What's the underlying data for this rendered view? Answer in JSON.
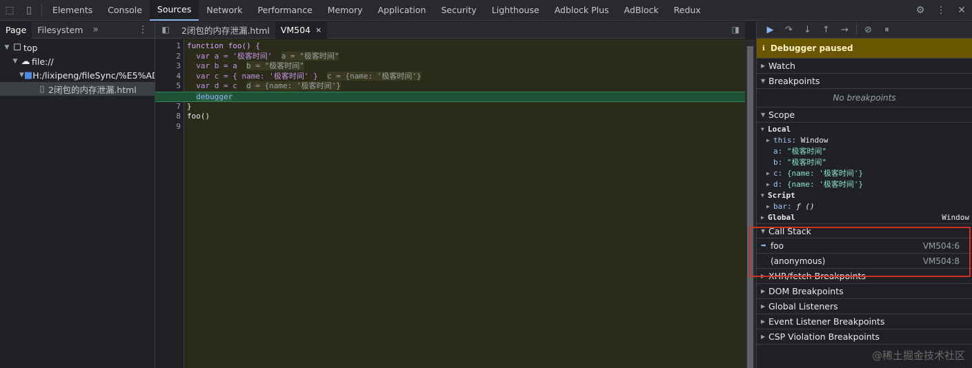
{
  "topbar": {
    "tabs": [
      "Elements",
      "Console",
      "Sources",
      "Network",
      "Performance",
      "Memory",
      "Application",
      "Security",
      "Lighthouse",
      "Adblock Plus",
      "AdBlock",
      "Redux"
    ],
    "active_tab": "Sources"
  },
  "navigator": {
    "tabs": [
      "Page",
      "Filesystem"
    ],
    "more": "»",
    "tree": [
      {
        "label": "top",
        "depth": 0,
        "icon": "frame-icon"
      },
      {
        "label": "file://",
        "depth": 1,
        "icon": "cloud-icon"
      },
      {
        "label": "H:/lixipeng/fileSync/%E5%AD%",
        "depth": 2,
        "icon": "folder-icon"
      },
      {
        "label": "2闭包的内存泄漏.html",
        "depth": 3,
        "icon": "file-icon"
      }
    ]
  },
  "editor": {
    "tabs": [
      {
        "label": "2闭包的内存泄漏.html",
        "active": false
      },
      {
        "label": "VM504",
        "active": true
      }
    ],
    "close_glyph": "×",
    "line_numbers": [
      "1",
      "2",
      "3",
      "4",
      "5",
      "6",
      "7",
      "8",
      "9"
    ],
    "code": {
      "l1": "function foo() {",
      "l2_a": "var a = '极客时间'",
      "l2_inl": "a = \"极客时间\"",
      "l3_a": "var b = a",
      "l3_inl": "b = \"极客时间\"",
      "l4_a": "var c = { name: '极客时间' }",
      "l4_inl": "c = {name: '极客时间'}",
      "l5_a": "var d = c",
      "l5_inl": "d = {name: '极客时间'}",
      "l6": "debugger",
      "l7": "}",
      "l8": "foo()"
    }
  },
  "debugger": {
    "paused_text": "Debugger paused",
    "sections": {
      "watch": "Watch",
      "breakpoints": "Breakpoints",
      "no_breakpoints": "No breakpoints",
      "scope": "Scope",
      "call_stack": "Call Stack",
      "xhr": "XHR/fetch Breakpoints",
      "dom": "DOM Breakpoints",
      "global_listeners": "Global Listeners",
      "event_listener": "Event Listener Breakpoints",
      "csp": "CSP Violation Breakpoints"
    },
    "scope": {
      "local": "Local",
      "this_key": "this:",
      "this_val": "Window",
      "a_key": "a:",
      "a_val": "\"极客时间\"",
      "b_key": "b:",
      "b_val": "\"极客时间\"",
      "c_key": "c:",
      "c_val": "{name: '极客时间'}",
      "d_key": "d:",
      "d_val": "{name: '极客时间'}",
      "script": "Script",
      "bar_key": "bar:",
      "bar_val": "ƒ ()",
      "global": "Global",
      "global_val": "Window"
    },
    "call_stack": [
      {
        "fn": "foo",
        "loc": "VM504:6",
        "current": true
      },
      {
        "fn": "(anonymous)",
        "loc": "VM504:8",
        "current": false
      }
    ]
  },
  "watermark": "@稀土掘金技术社区",
  "colors": {
    "accent": "#8ab4f8",
    "paused_banner": "#6a5600",
    "highlight": "#d33026",
    "exec_line": "#1e5036"
  }
}
